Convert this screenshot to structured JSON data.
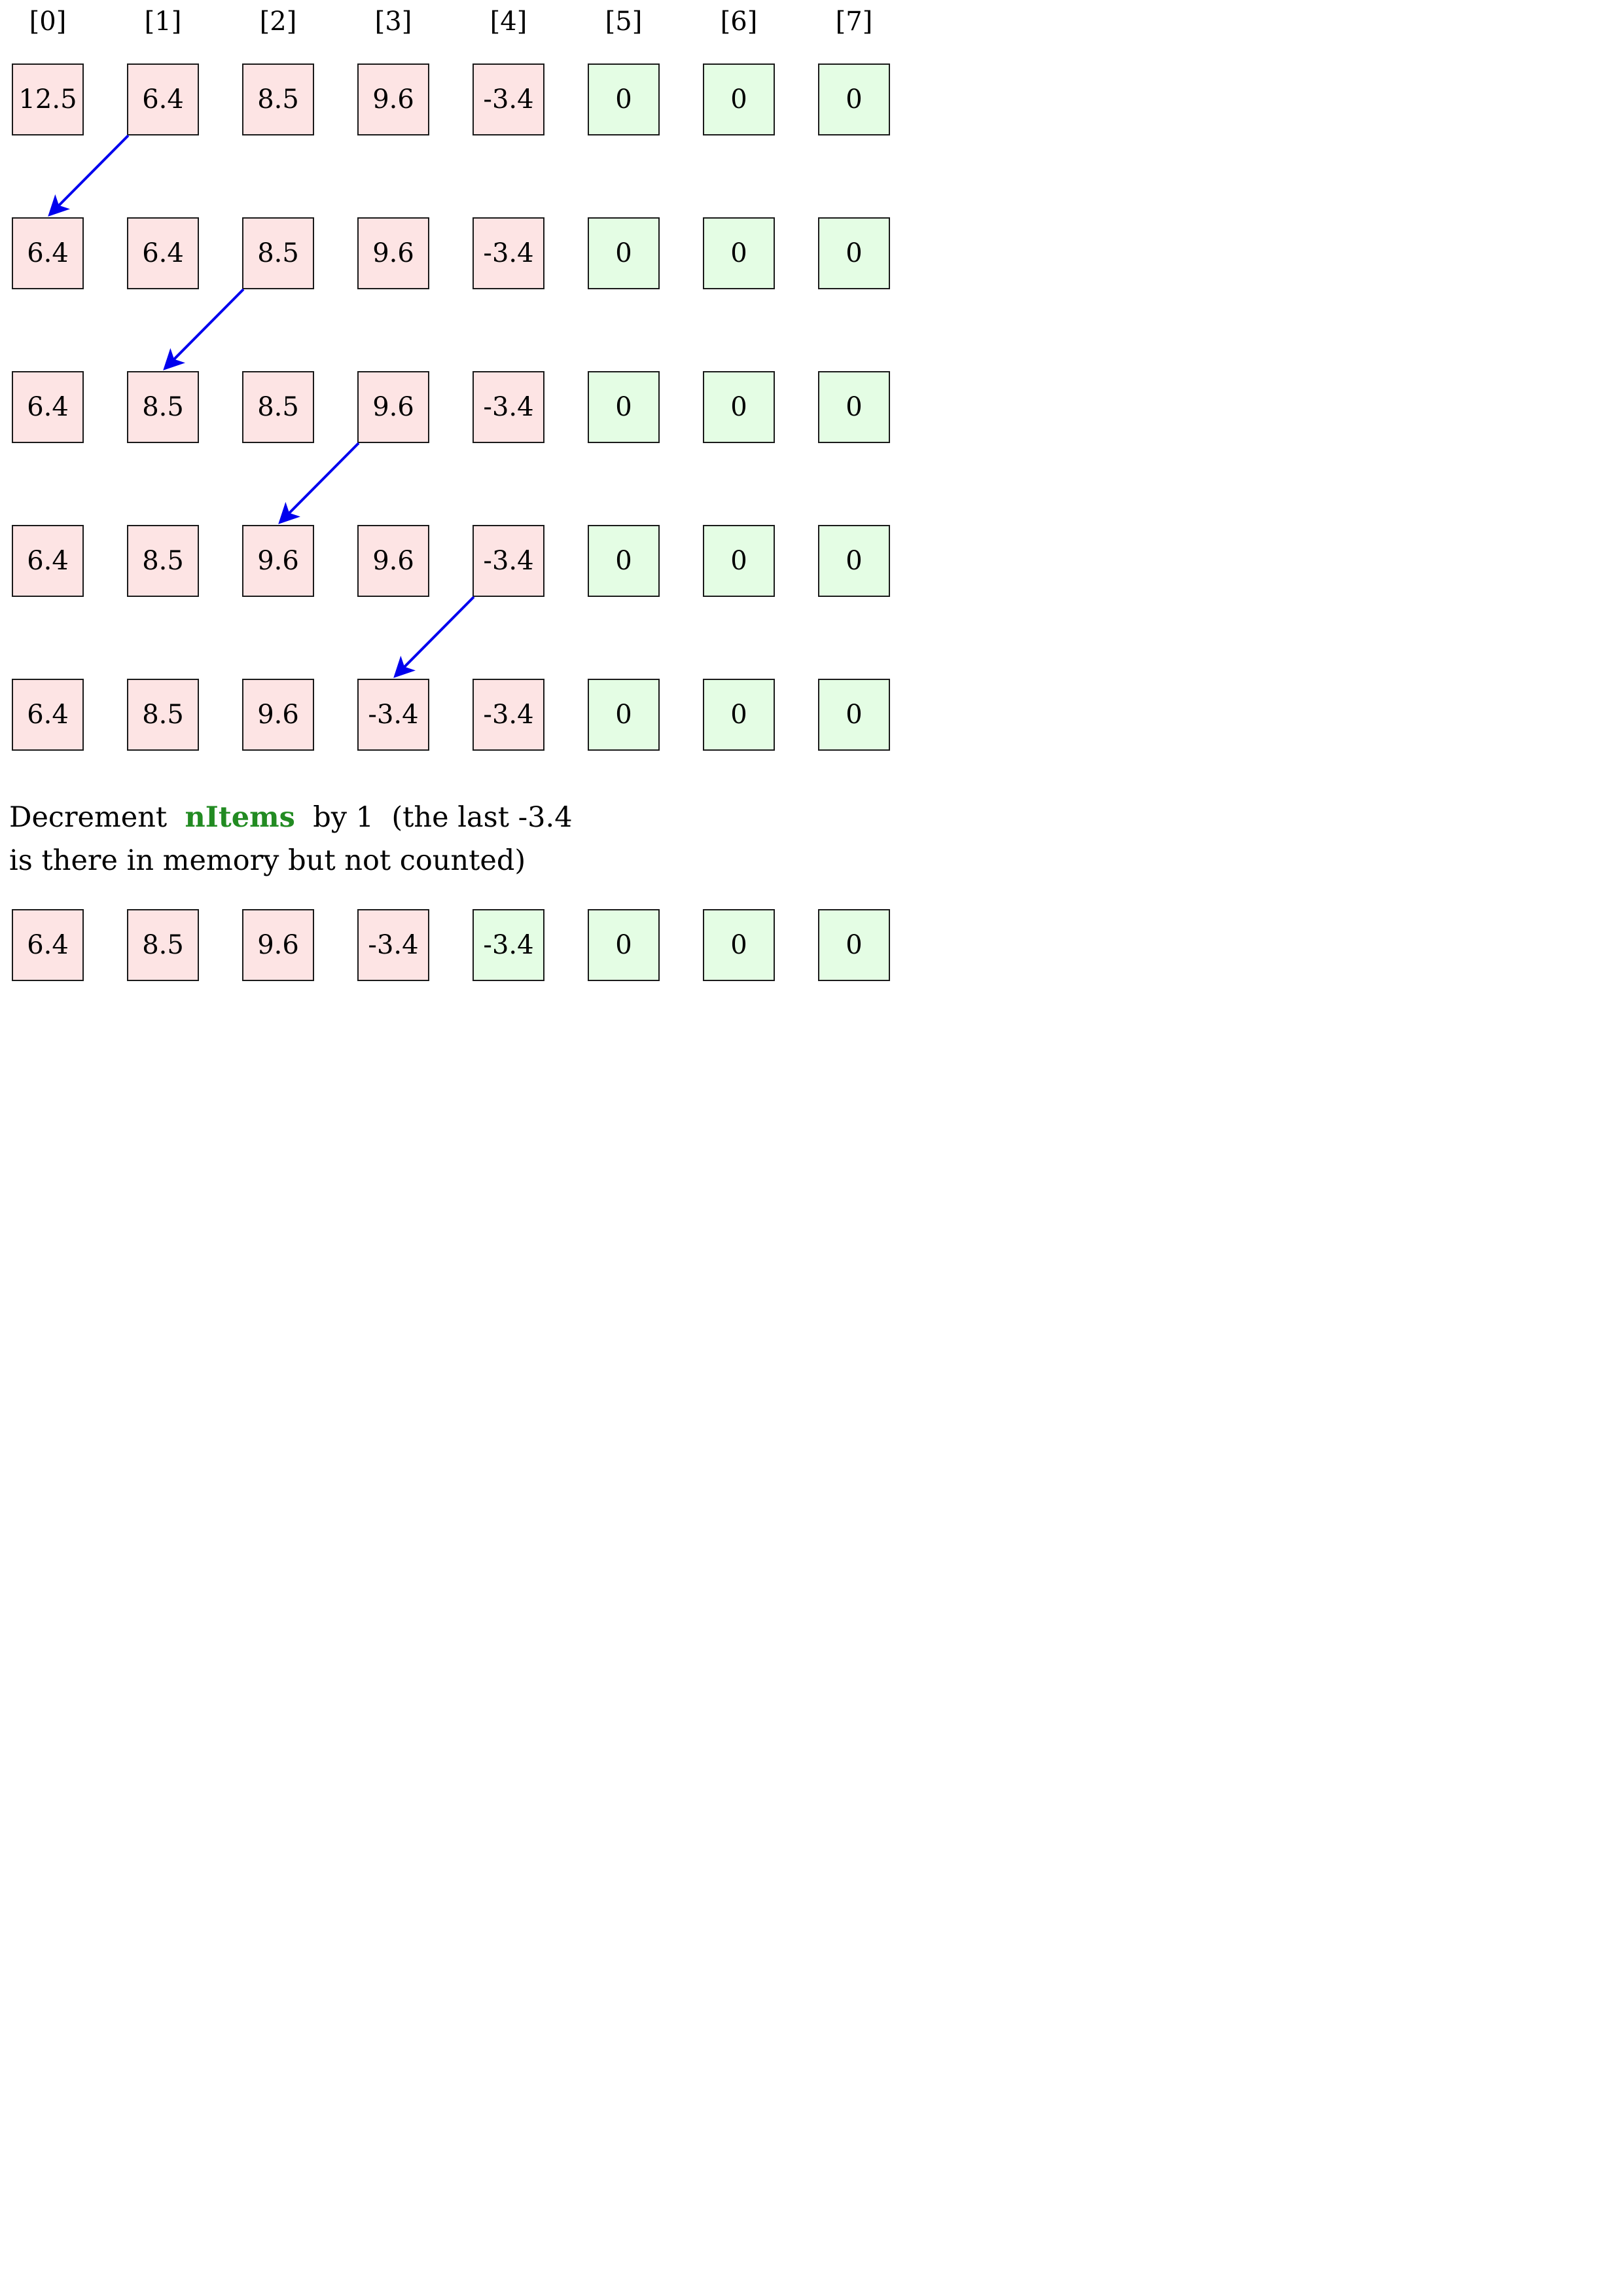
{
  "indices": [
    "[0]",
    "[1]",
    "[2]",
    "[3]",
    "[4]",
    "[5]",
    "[6]",
    "[7]"
  ],
  "rows": [
    [
      "12.5",
      "6.4",
      "8.5",
      "9.6",
      "-3.4",
      "0",
      "0",
      "0"
    ],
    [
      "6.4",
      "6.4",
      "8.5",
      "9.6",
      "-3.4",
      "0",
      "0",
      "0"
    ],
    [
      "6.4",
      "8.5",
      "8.5",
      "9.6",
      "-3.4",
      "0",
      "0",
      "0"
    ],
    [
      "6.4",
      "8.5",
      "9.6",
      "9.6",
      "-3.4",
      "0",
      "0",
      "0"
    ],
    [
      "6.4",
      "8.5",
      "9.6",
      "-3.4",
      "-3.4",
      "0",
      "0",
      "0"
    ]
  ],
  "row_fill": [
    [
      "pink",
      "pink",
      "pink",
      "pink",
      "pink",
      "green",
      "green",
      "green"
    ],
    [
      "pink",
      "pink",
      "pink",
      "pink",
      "pink",
      "green",
      "green",
      "green"
    ],
    [
      "pink",
      "pink",
      "pink",
      "pink",
      "pink",
      "green",
      "green",
      "green"
    ],
    [
      "pink",
      "pink",
      "pink",
      "pink",
      "pink",
      "green",
      "green",
      "green"
    ],
    [
      "pink",
      "pink",
      "pink",
      "pink",
      "pink",
      "green",
      "green",
      "green"
    ]
  ],
  "moves": [
    {
      "from_row": 0,
      "from_col": 1,
      "to_row": 1,
      "to_col": 0
    },
    {
      "from_row": 1,
      "from_col": 2,
      "to_row": 2,
      "to_col": 1
    },
    {
      "from_row": 2,
      "from_col": 3,
      "to_row": 3,
      "to_col": 2
    },
    {
      "from_row": 3,
      "from_col": 4,
      "to_row": 4,
      "to_col": 3
    }
  ],
  "note": {
    "line1_before": "Decrement  ",
    "line1_highlight": "nItems",
    "line1_after": "  by 1  (the last -3.4",
    "line2": "is there in memory but not counted)"
  },
  "final_row": [
    "6.4",
    "8.5",
    "9.6",
    "-3.4",
    "-3.4",
    "0",
    "0",
    "0"
  ],
  "final_fill": [
    "pink",
    "pink",
    "pink",
    "pink",
    "green",
    "green",
    "green",
    "green"
  ],
  "colors": {
    "pink": "#fde4e4",
    "green": "#e4fde4",
    "arrow": "#0000ee",
    "highlight": "#228b22"
  }
}
